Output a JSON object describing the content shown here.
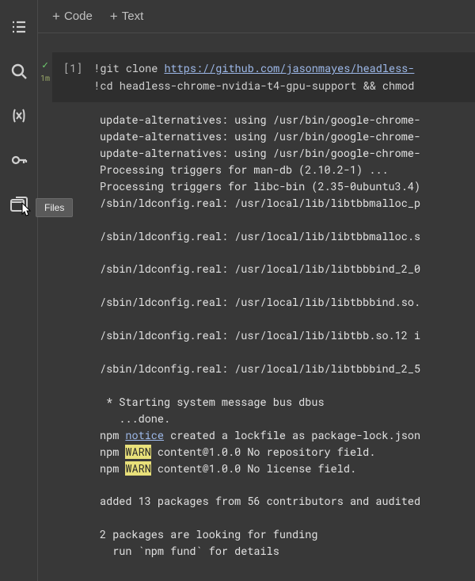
{
  "sidebar": {
    "tooltip": "Files"
  },
  "toolbar": {
    "code": "Code",
    "text": "Text"
  },
  "cell": {
    "prompt": "[1]",
    "status_time": "1m",
    "code": {
      "bang1": "!",
      "cmd1_a": "git clone ",
      "cmd1_url": "https://github.com/jasonmayes/headless-",
      "bang2": "!",
      "cmd2": "cd headless-chrome-nvidia-t4-gpu-support && chmod"
    }
  },
  "output": {
    "l1": "update-alternatives: using /usr/bin/google-chrome-",
    "l2": "update-alternatives: using /usr/bin/google-chrome-",
    "l3": "update-alternatives: using /usr/bin/google-chrome-",
    "l4": "Processing triggers for man-db (2.10.2-1) ...",
    "l5": "Processing triggers for libc-bin (2.35-0ubuntu3.4)",
    "l6": "/sbin/ldconfig.real: /usr/local/lib/libtbbmalloc_p",
    "l7": "",
    "l8": "/sbin/ldconfig.real: /usr/local/lib/libtbbmalloc.s",
    "l9": "",
    "l10": "/sbin/ldconfig.real: /usr/local/lib/libtbbbind_2_0",
    "l11": "",
    "l12": "/sbin/ldconfig.real: /usr/local/lib/libtbbbind.so.",
    "l13": "",
    "l14": "/sbin/ldconfig.real: /usr/local/lib/libtbb.so.12 i",
    "l15": "",
    "l16": "/sbin/ldconfig.real: /usr/local/lib/libtbbbind_2_5",
    "l17": "",
    "l18": " * Starting system message bus dbus",
    "l19": "   ...done.",
    "npm1_a": "npm ",
    "npm1_notice": "notice",
    "npm1_b": " created a lockfile as package-lock.json",
    "npm2_a": "npm ",
    "npm2_warn": "WARN",
    "npm2_b": " content@1.0.0 No repository field.",
    "npm3_a": "npm ",
    "npm3_warn": "WARN",
    "npm3_b": " content@1.0.0 No license field.",
    "l23": "",
    "l24": "added 13 packages from 56 contributors and audited",
    "l25": "",
    "l26": "2 packages are looking for funding",
    "l27": "  run `npm fund` for details"
  }
}
